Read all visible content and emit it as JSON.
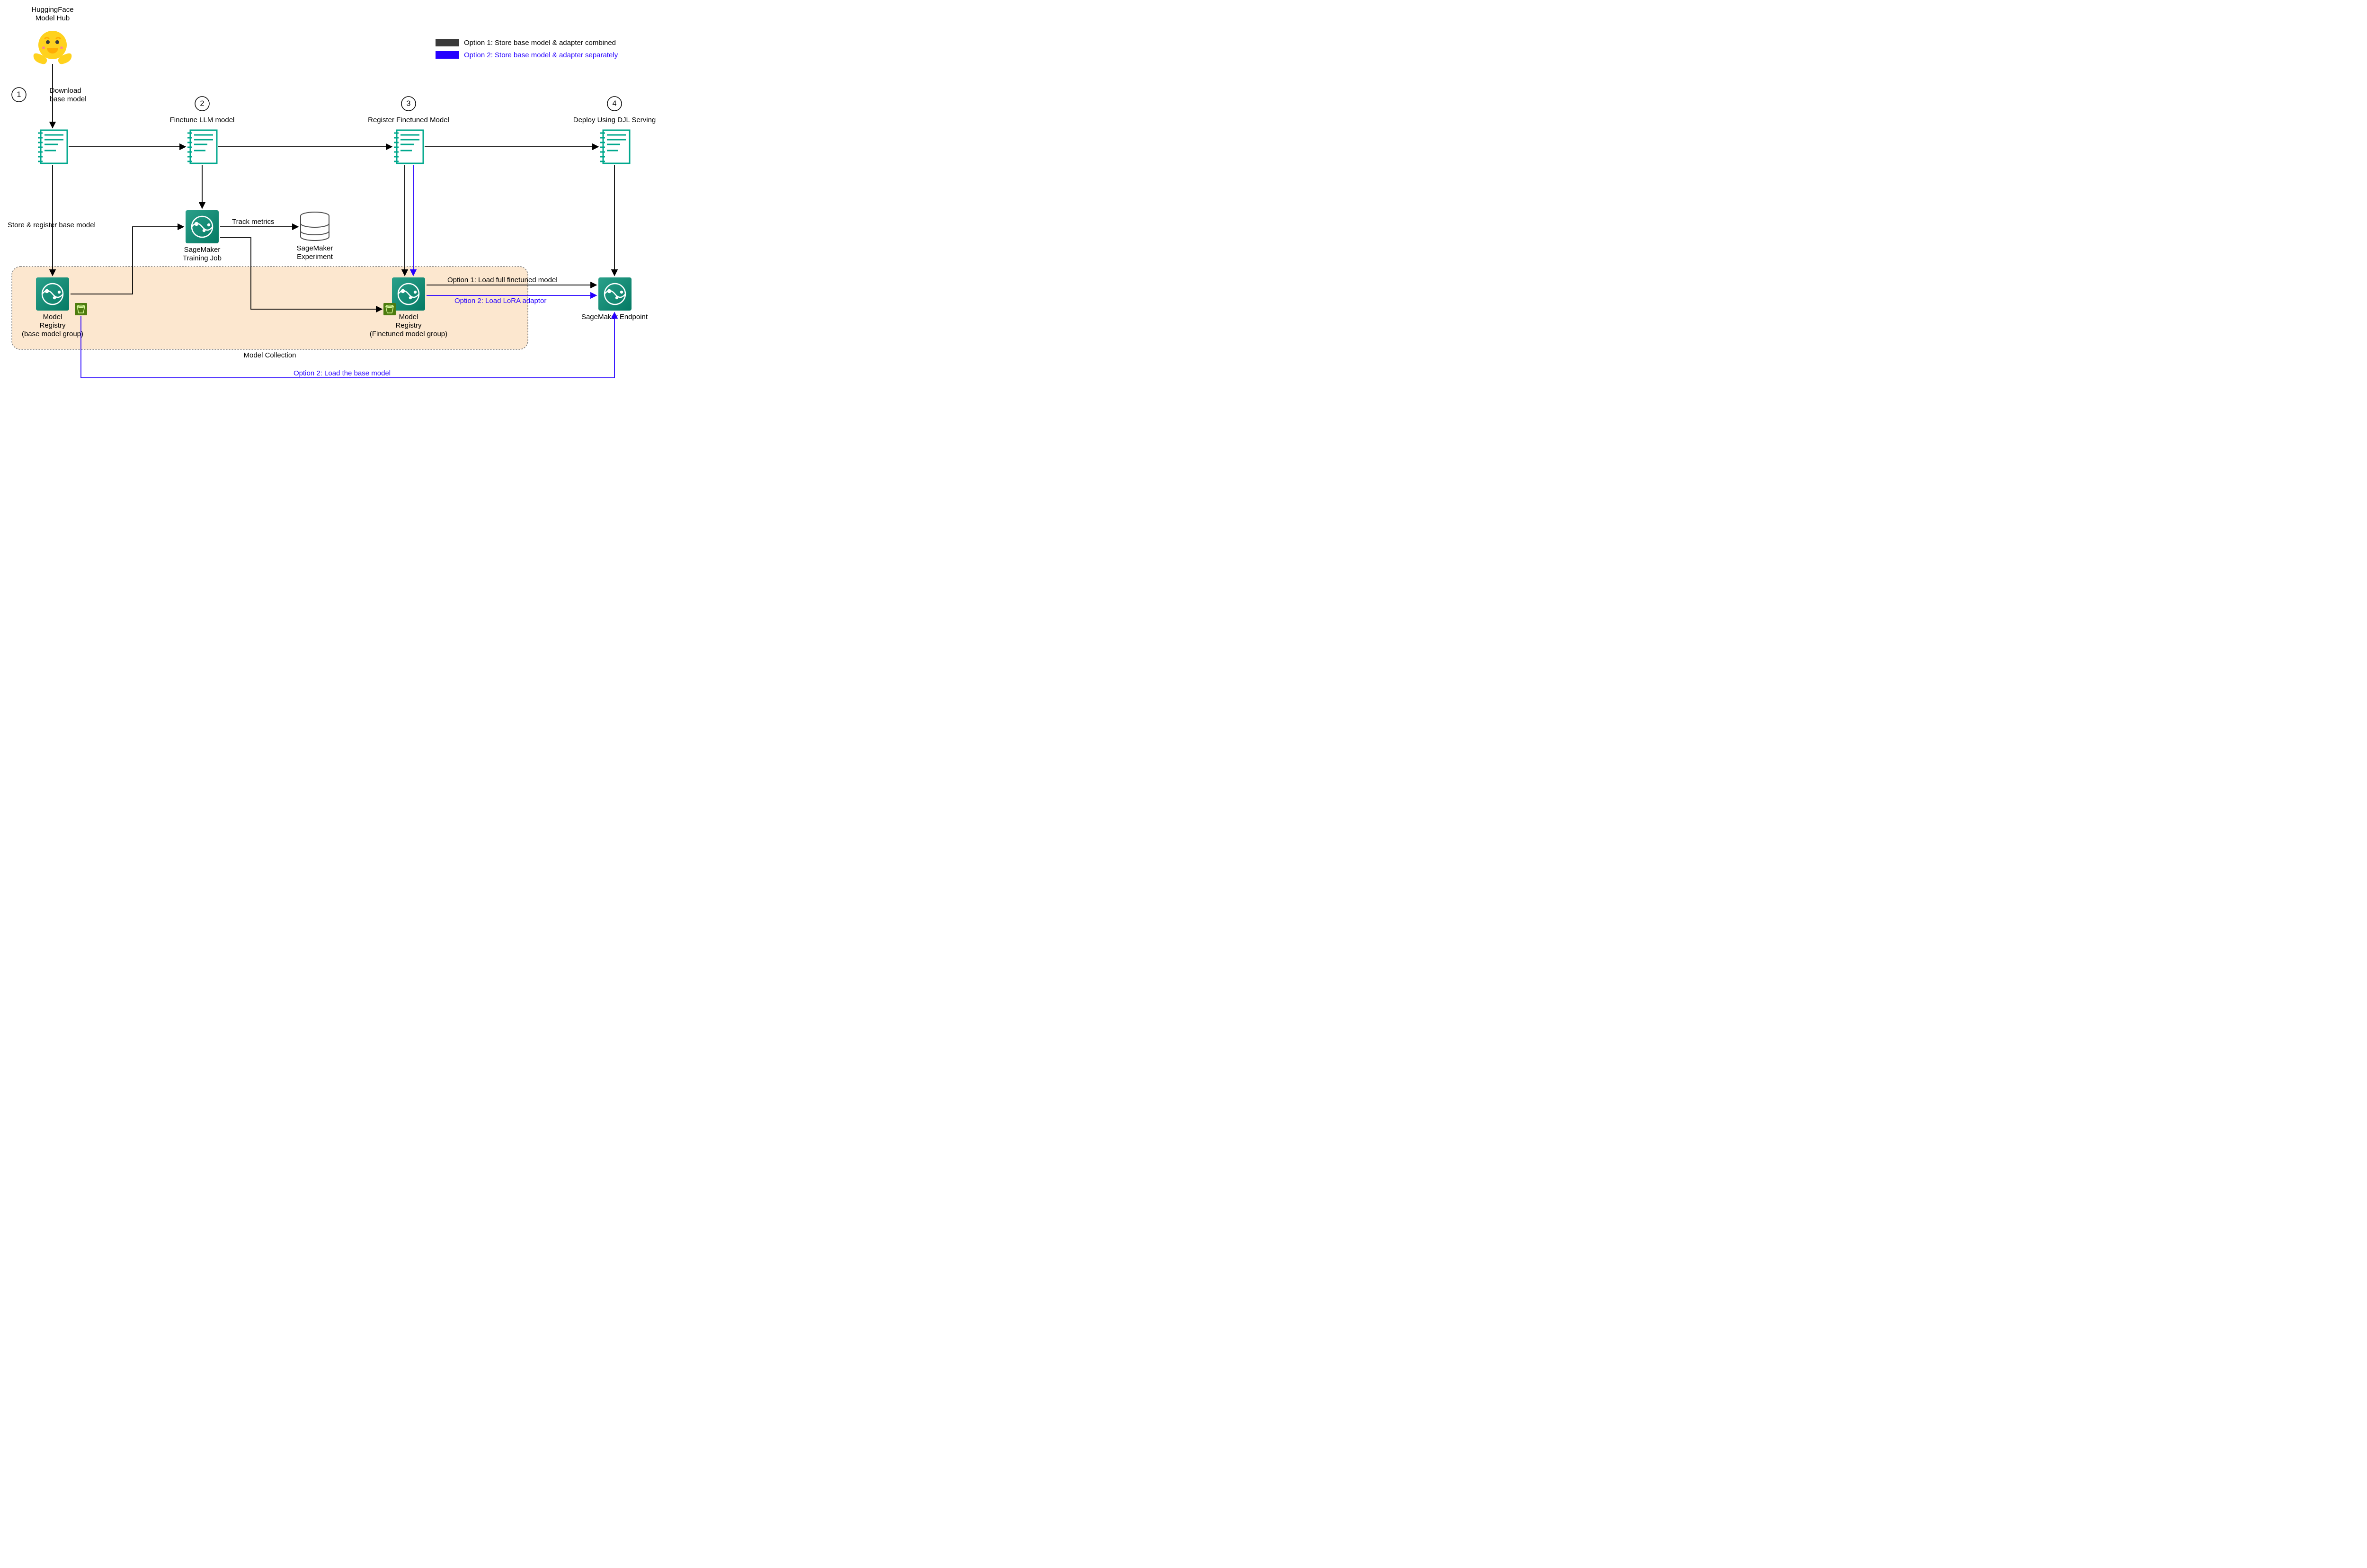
{
  "title": {
    "line1": "HuggingFace",
    "line2": "Model Hub"
  },
  "steps": {
    "s1": {
      "num": "1",
      "label_l1": "Download",
      "label_l2": "base model"
    },
    "s2": {
      "num": "2",
      "label": "Finetune LLM model"
    },
    "s3": {
      "num": "3",
      "label": "Register Finetuned Model"
    },
    "s4": {
      "num": "4",
      "label": "Deploy Using DJL Serving"
    }
  },
  "nodes": {
    "training_job_l1": "SageMaker",
    "training_job_l2": "Training Job",
    "experiment_l1": "SageMaker",
    "experiment_l2": "Experiment",
    "registry_base_l1": "Model",
    "registry_base_l2": "Registry",
    "registry_base_l3": "(base model group)",
    "registry_ft_l1": "Model",
    "registry_ft_l2": "Registry",
    "registry_ft_l3": "(Finetuned model group)",
    "endpoint": "SageMaker Endpoint",
    "collection": "Model Collection"
  },
  "edges": {
    "store_register": "Store & register base model",
    "track_metrics": "Track metrics",
    "opt1_load_full": "Option 1: Load full finetuned model",
    "opt2_load_lora": "Option 2: Load LoRA adaptor",
    "opt2_load_base": "Option 2: Load the base model"
  },
  "legend": {
    "opt1": "Option 1: Store base model & adapter combined",
    "opt2": "Option 2: Store base model & adapter separately"
  },
  "colors": {
    "black": "#000000",
    "blue": "#2500ff",
    "teal": "#01a88d",
    "tealDark": "#007b64",
    "peach": "#fce7cf",
    "peachStroke": "#7a7a7a",
    "green": "#4d7c0f",
    "hfYellow": "#ffd21e",
    "hfFace": "#ffac03",
    "dbGray": "#4d4d4d"
  }
}
